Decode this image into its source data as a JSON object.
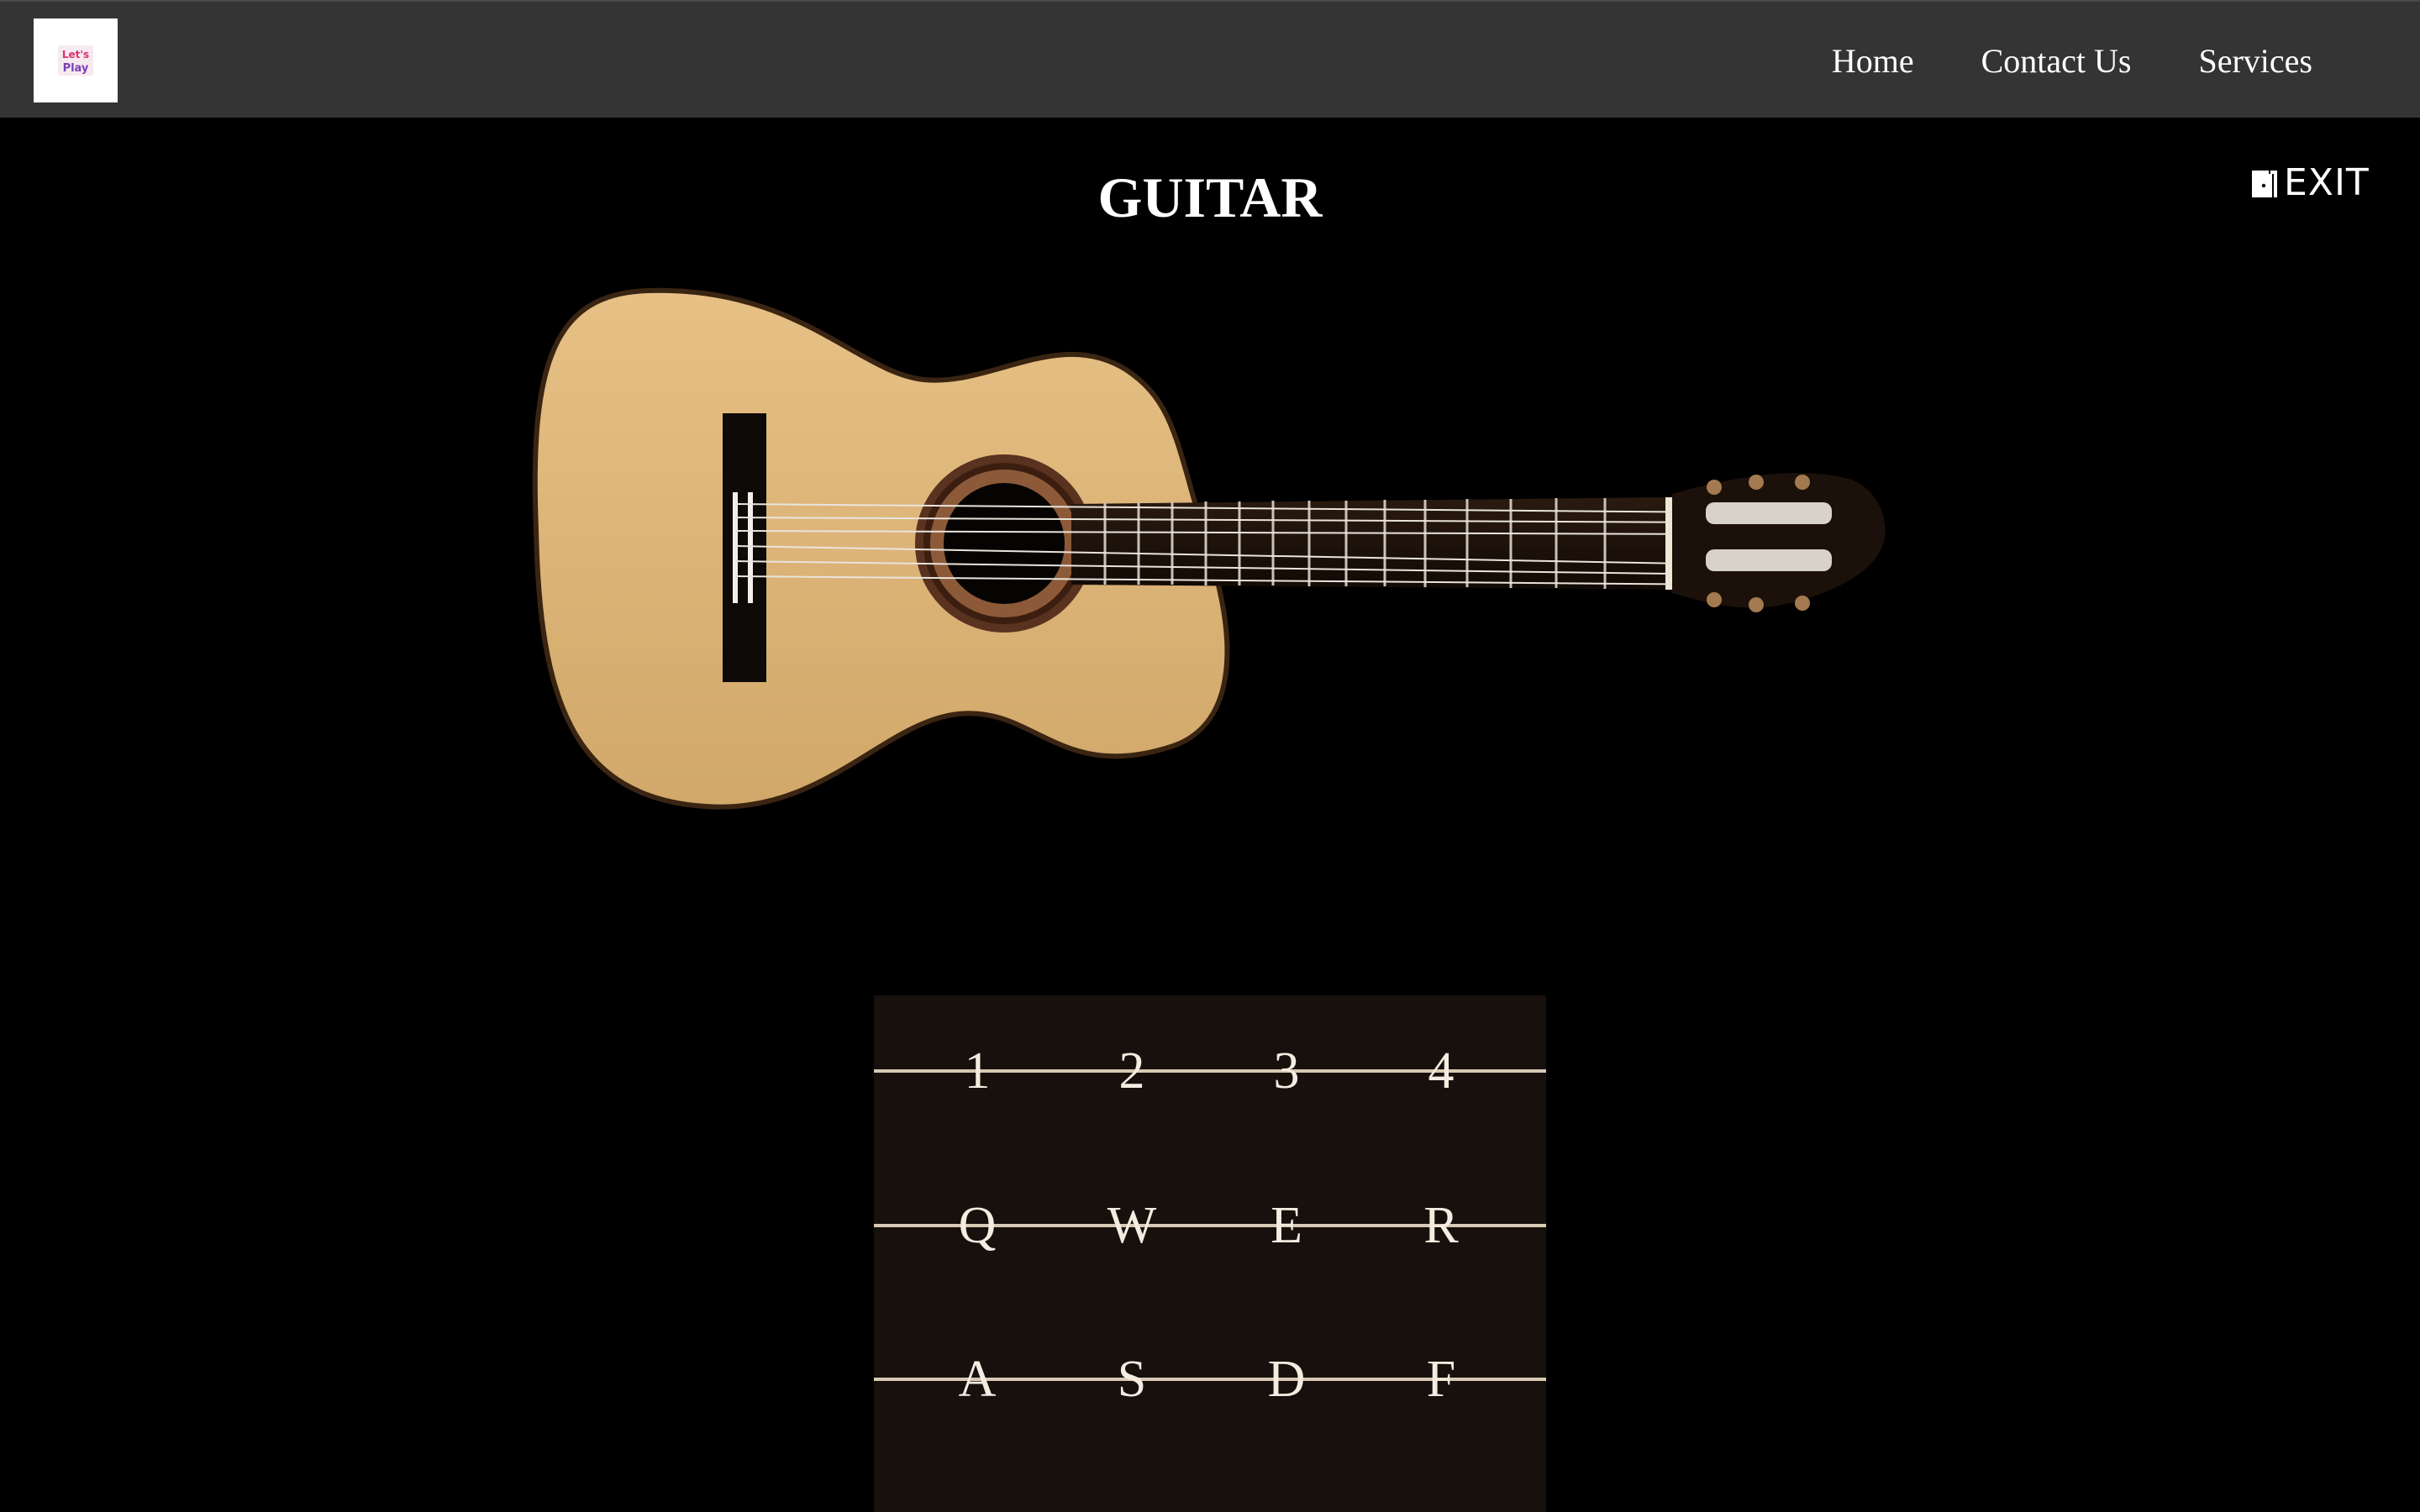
{
  "nav": {
    "links": [
      "Home",
      "Contact Us",
      "Services"
    ]
  },
  "logo": {
    "text_top": "Let's",
    "text_bottom": "Play"
  },
  "page": {
    "title": "GUITAR"
  },
  "exit": {
    "label": "EXIT",
    "icon": "door-exit-icon"
  },
  "keypad": {
    "rows": [
      [
        "1",
        "2",
        "3",
        "4"
      ],
      [
        "Q",
        "W",
        "E",
        "R"
      ],
      [
        "A",
        "S",
        "D",
        "F"
      ]
    ]
  },
  "colors": {
    "navbar": "#343434",
    "background": "#000000",
    "keypad_bg": "#17100c",
    "string": "#d9c9b4",
    "guitar_top": "#e2ba7c",
    "guitar_dark": "#1a0f08"
  }
}
